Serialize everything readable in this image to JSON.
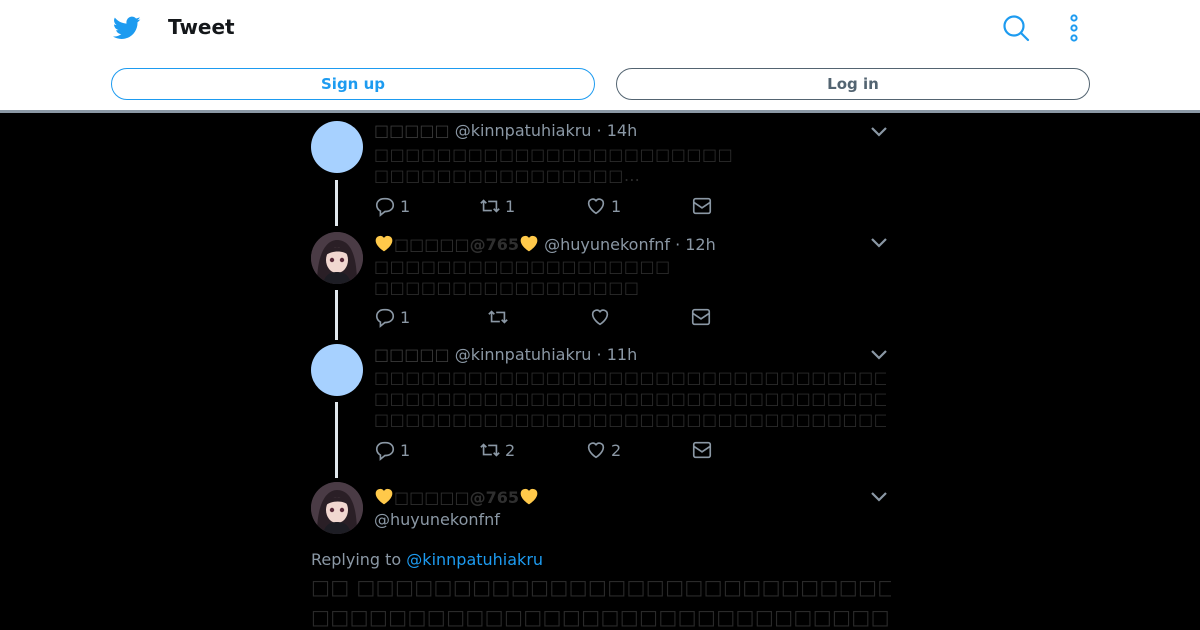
{
  "header": {
    "title": "Tweet",
    "signup_label": "Sign up",
    "login_label": "Log in",
    "accent": "#1d9bf0"
  },
  "tweets": [
    {
      "avatar": "blank",
      "display_name": "□□□□□",
      "handle": "@kinnpatuhiakru",
      "time": "· 14h",
      "lines": [
        "□□□□□□□□□□□□□□□□□□□□□□□",
        "□□□□□□□□□□□□□□□□…"
      ],
      "replies": "1",
      "retweets": "1",
      "likes": "1"
    },
    {
      "avatar": "photo",
      "display_name": "□□□□□@765",
      "handle": "@huyunekonfnf",
      "time": "· 12h",
      "lines": [
        "□□□□□□□□□□□□□□□□□□□",
        "□□□□□□□□□□□□□□□□□"
      ],
      "replies": "1",
      "retweets": "",
      "likes": ""
    },
    {
      "avatar": "blank",
      "display_name": "□□□□□",
      "handle": "@kinnpatuhiakru",
      "time": "· 11h",
      "lines": [
        "□□□□□□□□□□□□□□□□□□□□□□□□□□□□□□□□□□□□□□□□□□□□□□□□□□□□□□□□□□□",
        "□□□□□□□□□□□□□□□□□□□□□□□□□□□□□□□□□□□□□□□□□□□□□□□□□□□□□□□□□□□",
        "□□□□□□□□□□□□□□□□□□□□□□□□□□□□□□□□□□□□□□"
      ],
      "replies": "1",
      "retweets": "2",
      "likes": "2"
    }
  ],
  "main_tweet": {
    "display_name": "□□□□□@765",
    "handle": "@huyunekonfnf",
    "replying_prefix": "Replying to",
    "replying_handle": "@kinnpatuhiakru",
    "lines": [
      "□□ □□□□□□□□□□□□□□□□□□□□□□□□□□□□□□□□□□□□□□□□□□□□□□□□",
      "□□□□□□□□□□□□□□□□□□□□□□□□□□□□□□□□□□□□□□□□□□□□□★"
    ]
  }
}
